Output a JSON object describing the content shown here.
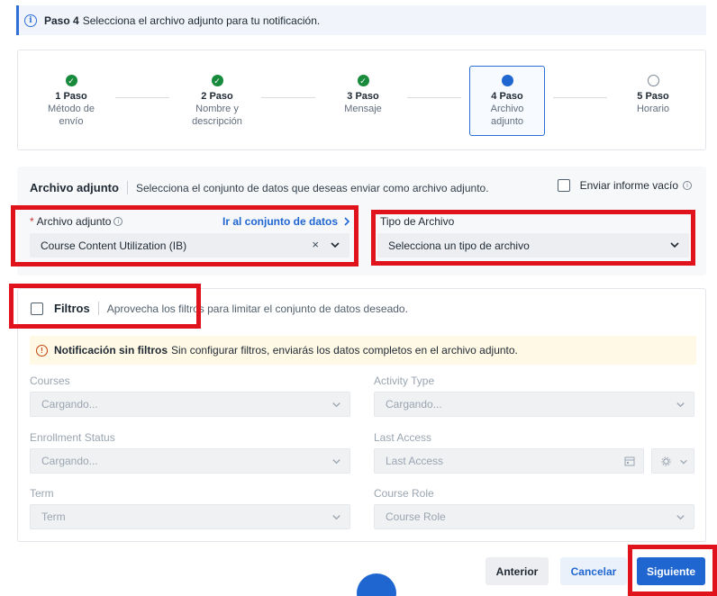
{
  "banner": {
    "step": "Paso 4",
    "text": "Selecciona el archivo adjunto para tu notificación."
  },
  "stepper": {
    "steps": [
      {
        "title": "1 Paso",
        "sub": "Método de envío",
        "state": "done"
      },
      {
        "title": "2 Paso",
        "sub": "Nombre y descripción",
        "state": "done"
      },
      {
        "title": "3 Paso",
        "sub": "Mensaje",
        "state": "done"
      },
      {
        "title": "4 Paso",
        "sub": "Archivo adjunto",
        "state": "current"
      },
      {
        "title": "5 Paso",
        "sub": "Horario",
        "state": "todo"
      }
    ]
  },
  "attachment": {
    "title": "Archivo adjunto",
    "description": "Selecciona el conjunto de datos que deseas enviar como archivo adjunto.",
    "empty_report_label": "Enviar informe vacío",
    "field_label": "Archivo adjunto",
    "dataset_link": "Ir al conjunto de datos",
    "dataset_value": "Course Content Utilization (IB)",
    "filetype_label": "Tipo de Archivo",
    "filetype_placeholder": "Selecciona un tipo de archivo"
  },
  "filters": {
    "title": "Filtros",
    "description": "Aprovecha los filtros para limitar el conjunto de datos deseado.",
    "warning_bold": "Notificación sin filtros",
    "warning_text": "Sin configurar filtros, enviarás los datos completos en el archivo adjunto.",
    "courses_label": "Courses",
    "courses_value": "Cargando...",
    "activity_label": "Activity Type",
    "activity_value": "Cargando...",
    "enrollment_label": "Enrollment Status",
    "enrollment_value": "Cargando...",
    "lastaccess_label": "Last Access",
    "lastaccess_value": "Last Access",
    "term_label": "Term",
    "term_value": "Term",
    "role_label": "Course Role",
    "role_value": "Course Role"
  },
  "footer": {
    "prev": "Anterior",
    "cancel": "Cancelar",
    "next": "Siguiente"
  },
  "colors": {
    "accent": "#1f66d1",
    "success": "#178a3c",
    "highlight": "#e0121b",
    "warning_bg": "#fff9e6"
  }
}
